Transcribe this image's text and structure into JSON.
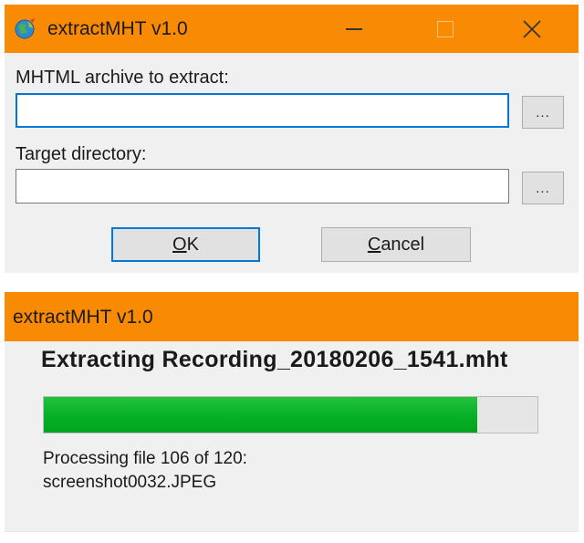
{
  "dialog": {
    "title": "extractMHT v1.0",
    "archive_label": "MHTML archive to extract:",
    "archive_value": "",
    "target_label": "Target directory:",
    "target_value": "",
    "browse_label": "...",
    "ok_label": "OK",
    "ok_underline": "O",
    "ok_rest": "K",
    "cancel_label": "Cancel",
    "cancel_underline": "C",
    "cancel_rest": "ancel",
    "caption_close": "✕"
  },
  "progress_window": {
    "title": "extractMHT v1.0",
    "heading": "Extracting Recording_20180206_1541.mht",
    "progress_fraction": 0.878,
    "status_line1": "Processing file 106 of 120:",
    "status_line2": "screenshot0032.JPEG"
  },
  "colors": {
    "titlebar": "#f88a04",
    "focus_border": "#0078d7",
    "progress_fill": "#06b025"
  },
  "icons": [
    "app-globe-icon",
    "minimize-icon",
    "maximize-icon",
    "close-icon"
  ]
}
